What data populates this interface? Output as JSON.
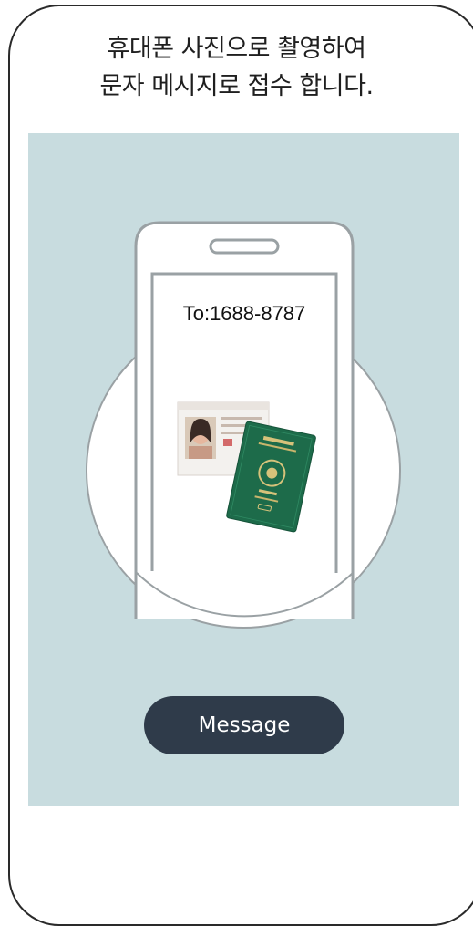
{
  "heading": {
    "line1": "휴대폰 사진으로 촬영하여",
    "line2": "문자 메시지로 접수 합니다."
  },
  "phone": {
    "recipient": "To:1688-8787"
  },
  "message_button": {
    "label": "Message"
  },
  "colors": {
    "panel_background": "#c8dcdf",
    "button_background": "#2f3b4a",
    "outline": "#2a2a2a",
    "passport_green": "#1d6b4a"
  },
  "icons": [
    "id-card-icon",
    "passport-icon"
  ]
}
